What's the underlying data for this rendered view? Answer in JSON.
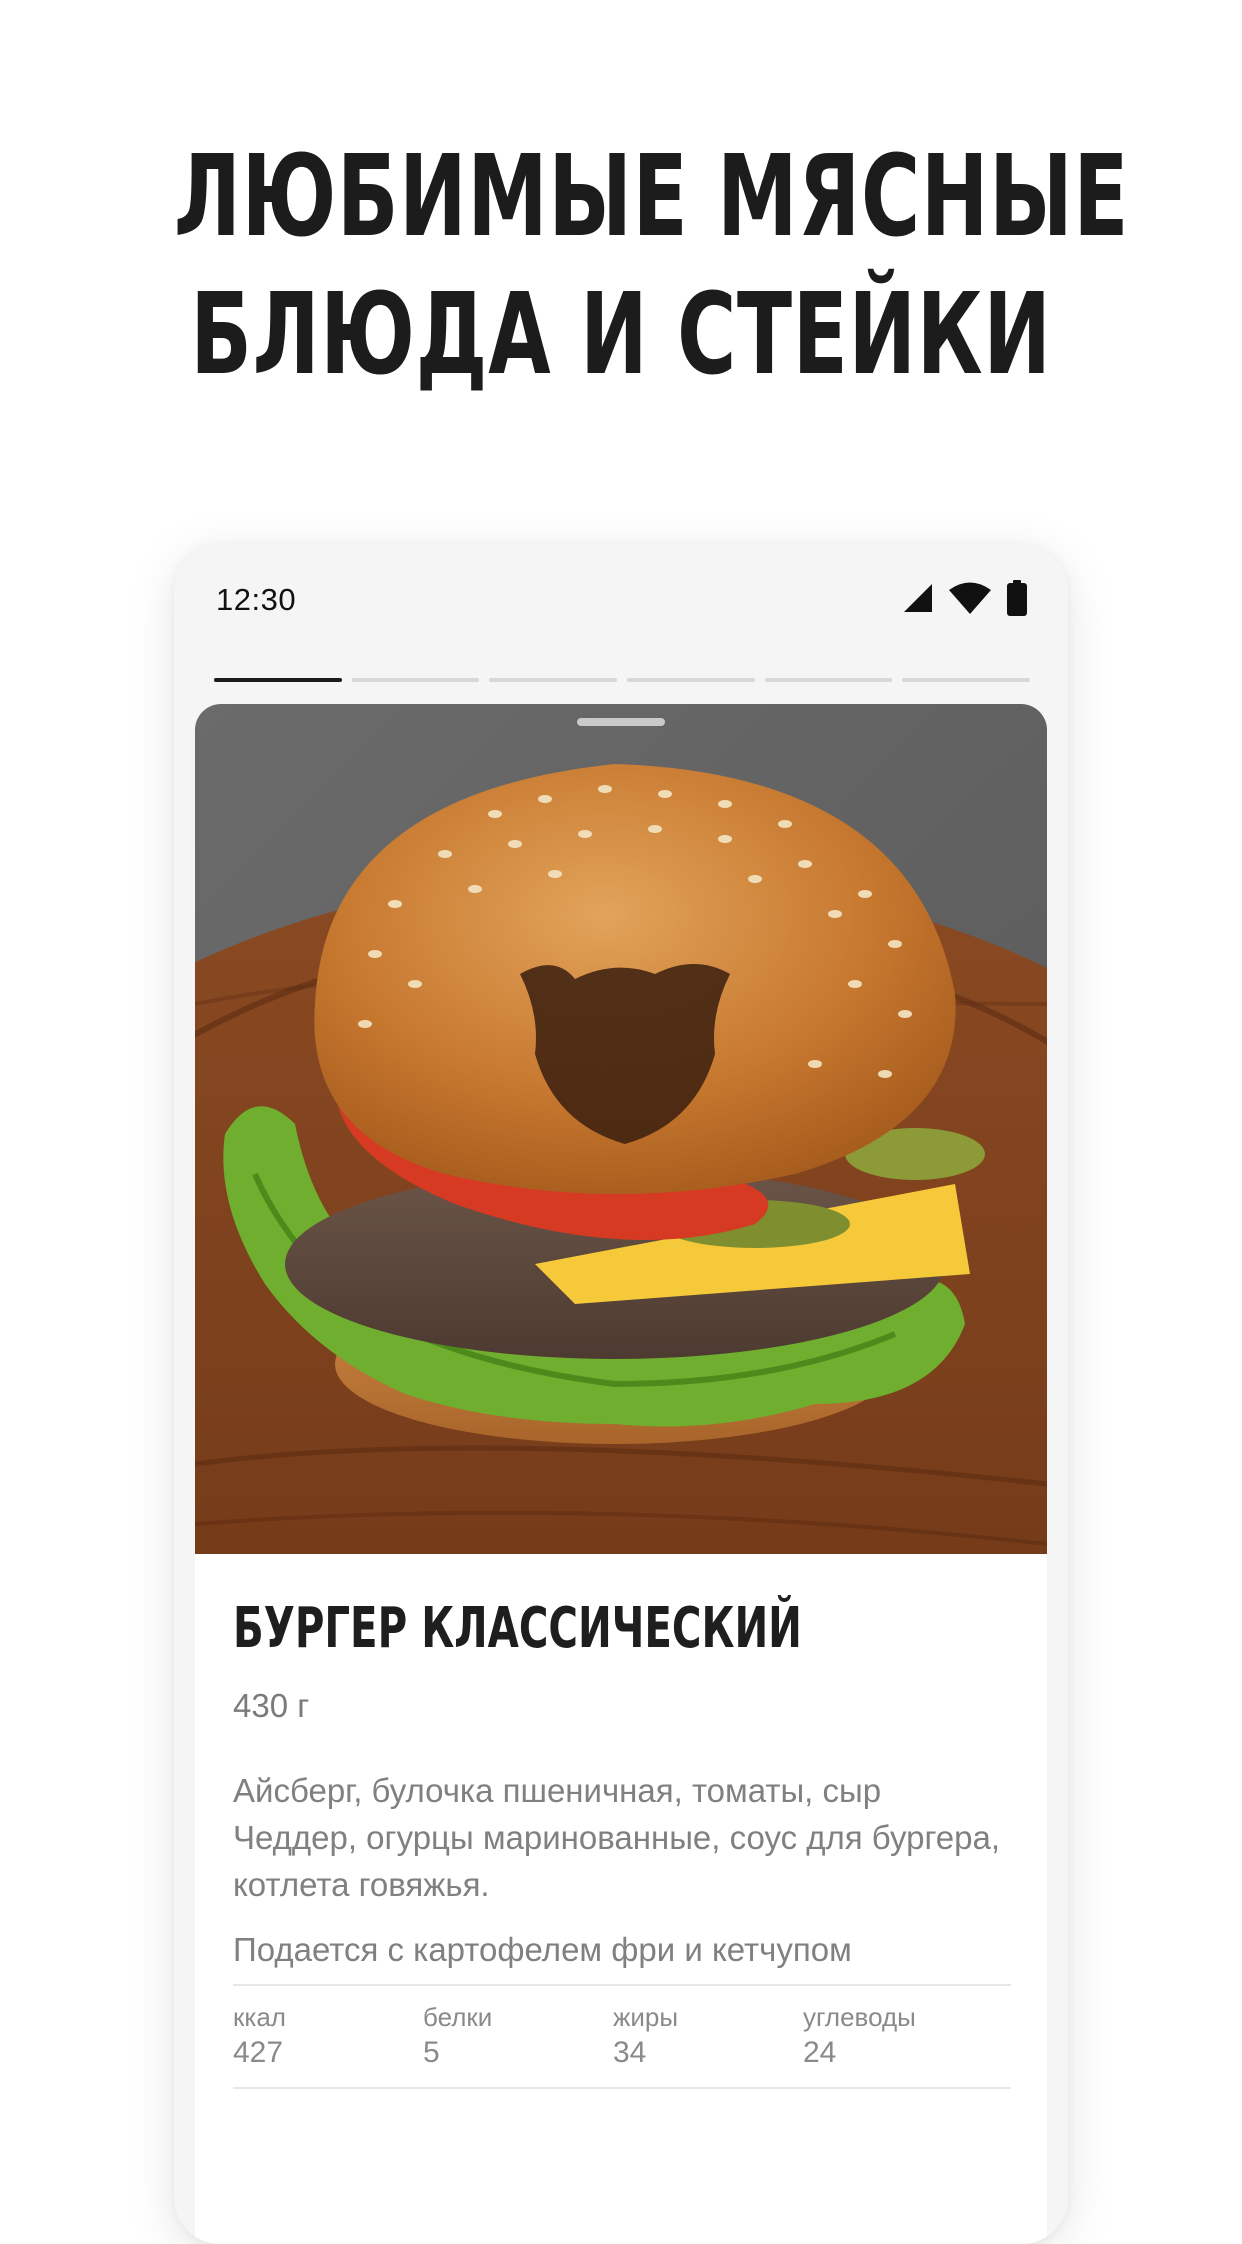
{
  "promo": {
    "headline_line1": "ЛЮБИМЫЕ МЯСНЫЕ",
    "headline_line2": "БЛЮДА И СТЕЙКИ"
  },
  "status_bar": {
    "time": "12:30",
    "icons": [
      "cellular-signal-icon",
      "wifi-icon",
      "battery-icon"
    ]
  },
  "story_progress": {
    "segments": 6,
    "active_index": 0
  },
  "dish": {
    "photo": "burger-photo",
    "title": "БУРГЕР КЛАССИЧЕСКИЙ",
    "weight": "430 г",
    "description": "Айсберг, булочка пшеничная, томаты, сыр Чеддер, огурцы маринованные, соус для бургера, котлета говяжья.",
    "serving": "Подается с картофелем фри и кетчупом",
    "nutrition": [
      {
        "label": "ккал",
        "value": "427"
      },
      {
        "label": "белки",
        "value": "5"
      },
      {
        "label": "жиры",
        "value": "34"
      },
      {
        "label": "углеводы",
        "value": "24"
      }
    ]
  },
  "colors": {
    "text_primary": "#1c1c1c",
    "text_secondary": "#808080",
    "frame_background": "#f5f5f5",
    "progress_active": "#1c1c1c",
    "progress_inactive": "#d8d8d8"
  }
}
